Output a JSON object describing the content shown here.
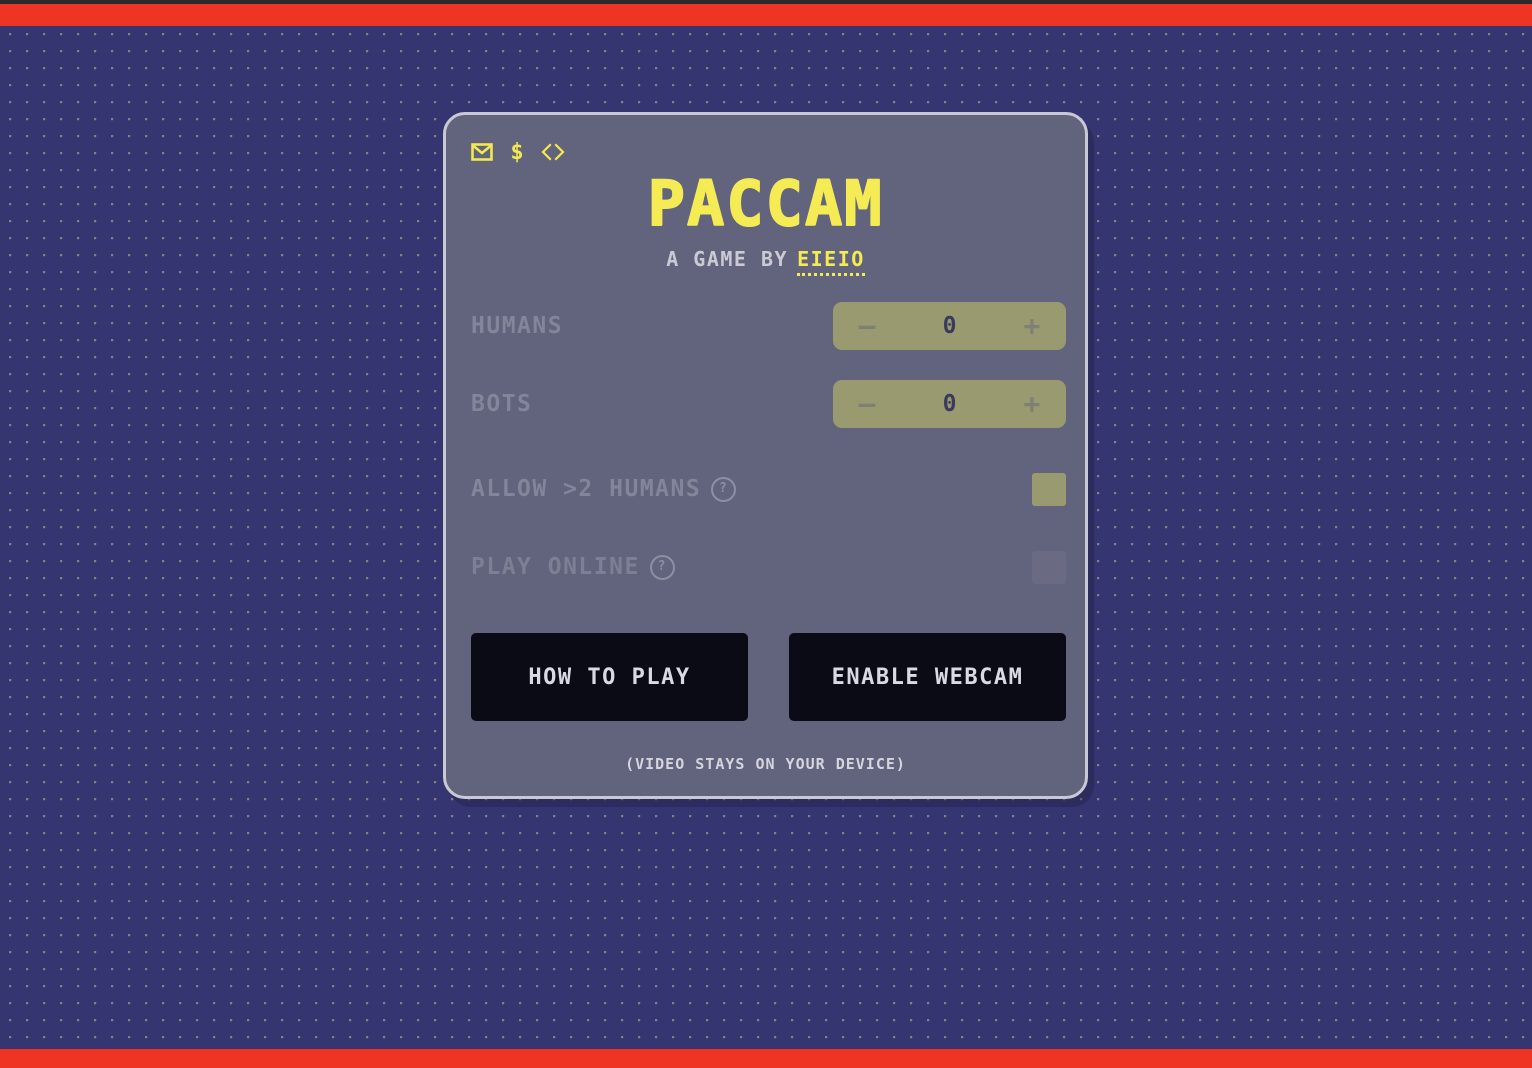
{
  "page": {
    "background_color": "#353572",
    "accent_bar_color": "#ee3524",
    "card_color": "#62637c",
    "card_border_color": "#c9c9d4",
    "highlight_color": "#f4eb55",
    "control_color": "#9a9a70"
  },
  "social": {
    "mail": "mail-icon",
    "donate": "dollar-icon",
    "code": "code-icon"
  },
  "logo": {
    "title": "PACCAM",
    "byline": "A GAME BY",
    "author": "EIEIO"
  },
  "settings": {
    "humans": {
      "label": "HUMANS",
      "value": "0",
      "decrement": "—",
      "increment": "+"
    },
    "bots": {
      "label": "BOTS",
      "value": "0",
      "decrement": "—",
      "increment": "+"
    },
    "allow_more_humans": {
      "label": "ALLOW >2 HUMANS",
      "help": "?",
      "checked": true
    },
    "play_online": {
      "label": "PLAY ONLINE",
      "help": "?",
      "checked": false
    }
  },
  "actions": {
    "how_to_play": "HOW TO PLAY",
    "enable_webcam": "ENABLE WEBCAM",
    "privacy_note": "(VIDEO STAYS ON YOUR DEVICE)"
  }
}
